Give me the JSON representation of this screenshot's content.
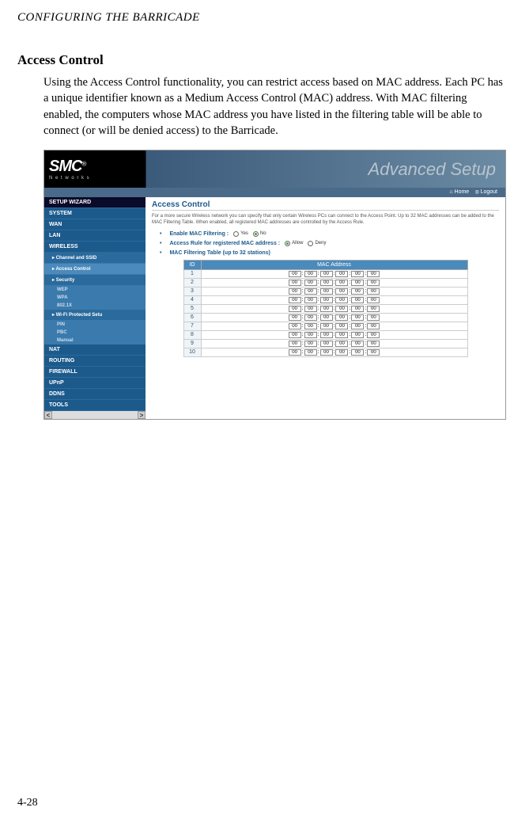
{
  "page_header": "CONFIGURING THE BARRICADE",
  "section_title": "Access Control",
  "body_paragraph": "Using the Access Control functionality, you can restrict access based on MAC address. Each PC has a unique identifier known as a Medium Access Control (MAC) address. With MAC filtering enabled, the computers whose MAC address you have listed in the filtering table will be able to connect (or will be denied access) to the Barricade.",
  "page_number": "4-28",
  "screenshot": {
    "logo": "SMC",
    "logo_sub": "N e t w o r k s",
    "banner": "Advanced Setup",
    "homebar": {
      "home": "Home",
      "logout": "Logout"
    },
    "sidebar": {
      "setup": "SETUP WIZARD",
      "items": [
        "SYSTEM",
        "WAN",
        "LAN",
        "WIRELESS"
      ],
      "wireless_subs": [
        "Channel and SSID",
        "Access Control",
        "Security"
      ],
      "sec_subs": [
        "WEP",
        "WPA",
        "802.1X"
      ],
      "wifi_prot": "Wi-Fi Protected Setu",
      "wifi_subs": [
        "PIN",
        "PBC",
        "Manual"
      ],
      "items2": [
        "NAT",
        "ROUTING",
        "FIREWALL",
        "UPnP",
        "DDNS",
        "TOOLS"
      ]
    },
    "content": {
      "title": "Access Control",
      "desc": "For a more secure Wireless network you can specify that only certain Wireless PCs can connect to the Access Point. Up to 32 MAC addresses can be added to the MAC Filtering Table. When enabled, all registered MAC addresses are controlled by the Access Rule.",
      "opt1_label": "Enable MAC Filtering :",
      "opt1_yes": "Yes",
      "opt1_no": "No",
      "opt2_label": "Access Rule for registered MAC address :",
      "opt2_allow": "Allow",
      "opt2_deny": "Deny",
      "opt3_label": "MAC Filtering Table (up to 32 stations)",
      "table": {
        "col_id": "ID",
        "col_mac": "MAC Address",
        "rows": [
          {
            "id": "1",
            "m": [
              "00",
              "00",
              "00",
              "00",
              "00",
              "00"
            ]
          },
          {
            "id": "2",
            "m": [
              "00",
              "00",
              "00",
              "00",
              "00",
              "00"
            ]
          },
          {
            "id": "3",
            "m": [
              "00",
              "00",
              "00",
              "00",
              "00",
              "00"
            ]
          },
          {
            "id": "4",
            "m": [
              "00",
              "00",
              "00",
              "00",
              "00",
              "00"
            ]
          },
          {
            "id": "5",
            "m": [
              "00",
              "00",
              "00",
              "00",
              "00",
              "00"
            ]
          },
          {
            "id": "6",
            "m": [
              "00",
              "00",
              "00",
              "00",
              "00",
              "00"
            ]
          },
          {
            "id": "7",
            "m": [
              "00",
              "00",
              "00",
              "00",
              "00",
              "00"
            ]
          },
          {
            "id": "8",
            "m": [
              "00",
              "00",
              "00",
              "00",
              "00",
              "00"
            ]
          },
          {
            "id": "9",
            "m": [
              "00",
              "00",
              "00",
              "00",
              "00",
              "00"
            ]
          },
          {
            "id": "10",
            "m": [
              "00",
              "00",
              "00",
              "00",
              "00",
              "00"
            ]
          }
        ]
      }
    }
  }
}
